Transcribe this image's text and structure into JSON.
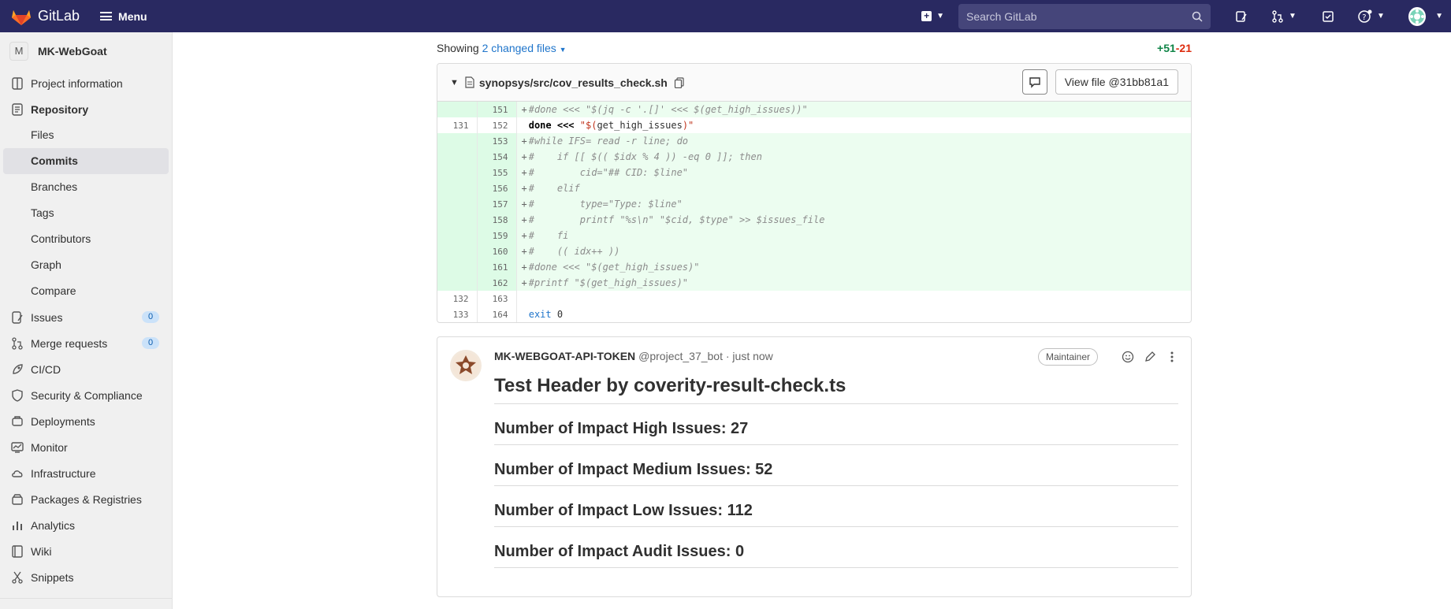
{
  "topbar": {
    "brand": "GitLab",
    "menu_label": "Menu",
    "search_placeholder": "Search GitLab"
  },
  "sidebar": {
    "project_initial": "M",
    "project_name": "MK-WebGoat",
    "items": {
      "project_information": "Project information",
      "repository": "Repository",
      "files": "Files",
      "commits": "Commits",
      "branches": "Branches",
      "tags": "Tags",
      "contributors": "Contributors",
      "graph": "Graph",
      "compare": "Compare",
      "issues": "Issues",
      "issues_count": "0",
      "merge_requests": "Merge requests",
      "merge_requests_count": "0",
      "cicd": "CI/CD",
      "security": "Security & Compliance",
      "deployments": "Deployments",
      "monitor": "Monitor",
      "infrastructure": "Infrastructure",
      "packages": "Packages & Registries",
      "analytics": "Analytics",
      "wiki": "Wiki",
      "snippets": "Snippets"
    }
  },
  "diff": {
    "showing_prefix": "Showing",
    "changed_files": "2 changed files",
    "additions": "+51",
    "deletions": "-21",
    "file_path": "synopsys/src/cov_results_check.sh",
    "view_file_label": "View file @31bb81a1",
    "lines": [
      {
        "old": "",
        "new": "151",
        "sign": "+",
        "type": "added",
        "text": "#done <<< \"$(jq -c '.[]' <<< $(get_high_issues))\""
      },
      {
        "old": "131",
        "new": "152",
        "sign": "",
        "type": "context",
        "kw": "done <<< ",
        "str1": "\"$(",
        "mid": "get_high_issues",
        "str2": ")\""
      },
      {
        "old": "",
        "new": "153",
        "sign": "+",
        "type": "added",
        "text": "#while IFS= read -r line; do"
      },
      {
        "old": "",
        "new": "154",
        "sign": "+",
        "type": "added",
        "text": "#    if [[ $(( $idx % 4 )) -eq 0 ]]; then"
      },
      {
        "old": "",
        "new": "155",
        "sign": "+",
        "type": "added",
        "text": "#        cid=\"## CID: $line\""
      },
      {
        "old": "",
        "new": "156",
        "sign": "+",
        "type": "added",
        "text": "#    elif"
      },
      {
        "old": "",
        "new": "157",
        "sign": "+",
        "type": "added",
        "text": "#        type=\"Type: $line\""
      },
      {
        "old": "",
        "new": "158",
        "sign": "+",
        "type": "added",
        "text": "#        printf \"%s\\n\" \"$cid, $type\" >> $issues_file"
      },
      {
        "old": "",
        "new": "159",
        "sign": "+",
        "type": "added",
        "text": "#    fi"
      },
      {
        "old": "",
        "new": "160",
        "sign": "+",
        "type": "added",
        "text": "#    (( idx++ ))"
      },
      {
        "old": "",
        "new": "161",
        "sign": "+",
        "type": "added",
        "text": "#done <<< \"$(get_high_issues)\""
      },
      {
        "old": "",
        "new": "162",
        "sign": "+",
        "type": "added",
        "text": "#printf \"$(get_high_issues)\""
      },
      {
        "old": "132",
        "new": "163",
        "sign": "",
        "type": "context",
        "text": ""
      },
      {
        "old": "133",
        "new": "164",
        "sign": "",
        "type": "exit",
        "kw": "exit",
        "num": " 0"
      }
    ]
  },
  "note": {
    "author": "MK-WEBGOAT-API-TOKEN",
    "handle": "@project_37_bot · just now",
    "role": "Maintainer",
    "heading": "Test Header by coverity-result-check.ts",
    "sections": [
      "Number of Impact High Issues: 27",
      "Number of Impact Medium Issues: 52",
      "Number of Impact Low Issues: 112",
      "Number of Impact Audit Issues: 0"
    ]
  }
}
